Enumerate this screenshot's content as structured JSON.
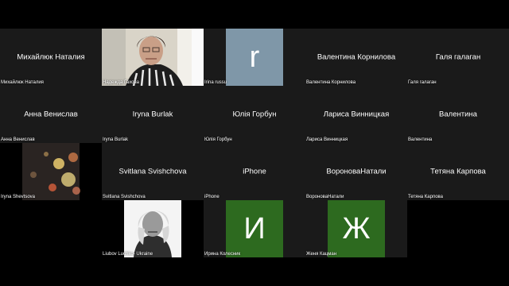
{
  "participants": [
    {
      "id": "p1",
      "display": "Михайлюк Наталия",
      "label": "Михайлюк Наталия"
    },
    {
      "id": "p2",
      "display": "",
      "label": "Надежда Гахова"
    },
    {
      "id": "p3",
      "display": "",
      "label": "Irina russu",
      "avatar_letter": "r",
      "avatar_color": "#7f97a8"
    },
    {
      "id": "p4",
      "display": "Валентина Корнилова",
      "label": "Валентина Корнилова"
    },
    {
      "id": "p5",
      "display": "Галя галаган",
      "label": "Галя галаган"
    },
    {
      "id": "p6",
      "display": "Анна Венислав",
      "label": "Анна Венислав"
    },
    {
      "id": "p7",
      "display": "Iryna Burlak",
      "label": "Iryna Burlak"
    },
    {
      "id": "p8",
      "display": "Юлія Горбун",
      "label": "Юлія Горбун"
    },
    {
      "id": "p9",
      "display": "Лариса Винницкая",
      "label": "Лариса Винницкая"
    },
    {
      "id": "p10",
      "display": "Валентина",
      "label": "Валентина"
    },
    {
      "id": "p11",
      "display": "",
      "label": "Iryna Shevtsova"
    },
    {
      "id": "p12",
      "display": "Svitlana Svishchova",
      "label": "Svitlana Svishchova"
    },
    {
      "id": "p13",
      "display": "iPhone",
      "label": "iPhone"
    },
    {
      "id": "p14",
      "display": "ВороноваНатали",
      "label": "ВороноваНатали"
    },
    {
      "id": "p15",
      "display": "Тетяна Карпова",
      "label": "Тетяна Карпова"
    },
    {
      "id": "p16",
      "display": "",
      "label": "Liubov Luchko- Ukraine"
    },
    {
      "id": "p17",
      "display": "",
      "label": "Ирина Колесник",
      "avatar_letter": "И",
      "avatar_color": "#2d6a1f"
    },
    {
      "id": "p18",
      "display": "",
      "label": "Женя Кацман",
      "avatar_letter": "Ж",
      "avatar_color": "#2d6a1f"
    }
  ]
}
